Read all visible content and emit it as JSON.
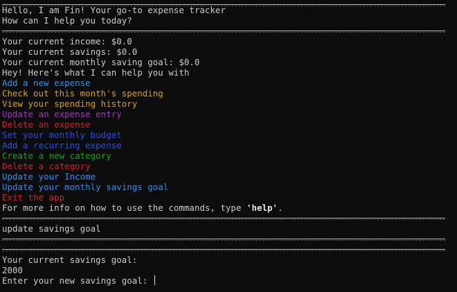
{
  "greeting": {
    "line1": "Hello, I am Fin! Your go-to expense tracker",
    "line2": "How can I help you today?"
  },
  "status": {
    "income": "Your current income: $0.0",
    "savings": "Your current savings: $0.0",
    "goal": "Your current monthly saving goal: $0.0"
  },
  "menu": {
    "intro": "Hey! Here's what I can help you with",
    "items": [
      {
        "label": "Add a new expense",
        "color": "#3b8eea"
      },
      {
        "label": "Check out this month's spending",
        "color": "#d7a21f"
      },
      {
        "label": "View your spending history",
        "color": "#d7a21f"
      },
      {
        "label": "Update an expense entry",
        "color": "#a335c2"
      },
      {
        "label": "Delete an expense",
        "color": "#d0242f"
      },
      {
        "label": "Set your monthly budget",
        "color": "#2a4fe0"
      },
      {
        "label": "Add a recurring expense",
        "color": "#2a4fe0"
      },
      {
        "label": "Create a new category",
        "color": "#19a319"
      },
      {
        "label": "Delete a category",
        "color": "#d0242f"
      },
      {
        "label": "Update your Income",
        "color": "#3b8eea"
      },
      {
        "label": "Update your monthly savings goal",
        "color": "#3b8eea"
      },
      {
        "label": "Exit the app",
        "color": "#d0242f"
      }
    ],
    "help_prefix": "For more info on how to use the commands, type ",
    "help_keyword": "'help'",
    "help_suffix": "."
  },
  "command": {
    "input": "update savings goal"
  },
  "response": {
    "label": "Your current savings goal:",
    "value": "2000",
    "prompt": "Enter your new savings goal: "
  }
}
